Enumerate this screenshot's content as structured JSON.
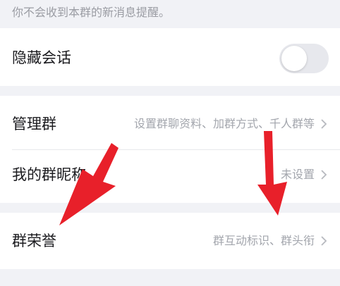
{
  "hint": "你不会收到本群的新消息提醒。",
  "hide_chat": {
    "label": "隐藏会话",
    "toggle_on": false
  },
  "manage_group": {
    "label": "管理群",
    "value": "设置群聊资料、加群方式、千人群等"
  },
  "nickname": {
    "label": "我的群昵称",
    "value": "未设置"
  },
  "honor": {
    "label": "群荣誉",
    "value": "群互动标识、群头衔"
  },
  "colors": {
    "background": "#f1f2f6",
    "card": "#ffffff",
    "arrow": "#e8202a"
  },
  "icons": [
    "chevron-right-icon",
    "red-arrow-annotation"
  ]
}
